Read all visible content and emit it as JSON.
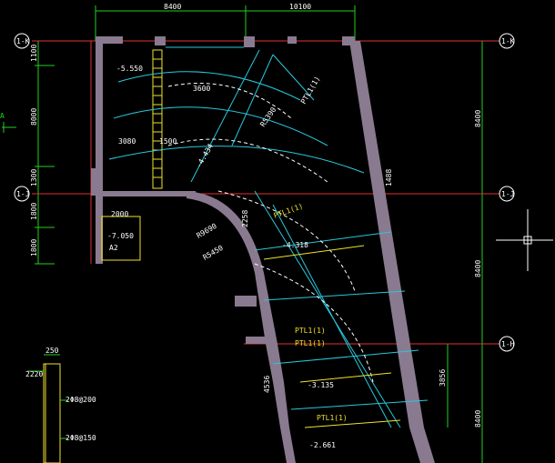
{
  "drawing": {
    "top_dims": [
      "8400",
      "10100"
    ],
    "left_dims": [
      "1100",
      "8000",
      "1300",
      "1800",
      "1800"
    ],
    "right_dims": [
      "8400",
      "8400",
      "8400",
      "3856"
    ],
    "axis_tags": [
      "1-K",
      "1-J",
      "1-H"
    ],
    "levels": [
      "-5.550",
      "-4.434",
      "-7.050",
      "-4.318",
      "-3.135",
      "-2.661"
    ],
    "radius_labels": [
      "R5390",
      "R9690",
      "R5450"
    ],
    "beam_labels": [
      "PTL1(1)",
      "PTL1(1)",
      "PTL1(1)",
      "PTL1(1)",
      "PTL1(1)"
    ],
    "misc_labels": [
      "3600",
      "3080",
      "2000",
      "2000",
      "2258",
      "1488",
      "1500",
      "4536",
      "250",
      "2220",
      "2Φ8@200",
      "2Φ8@150",
      "A",
      "A2"
    ],
    "colors": {
      "background": "#000000",
      "wall": "#8a7a8f",
      "grid_green": "#1fd11f",
      "axis_red": "#e23232",
      "cyan": "#28c8dc",
      "yellow": "#f0e22a",
      "white": "#ffffff"
    }
  }
}
